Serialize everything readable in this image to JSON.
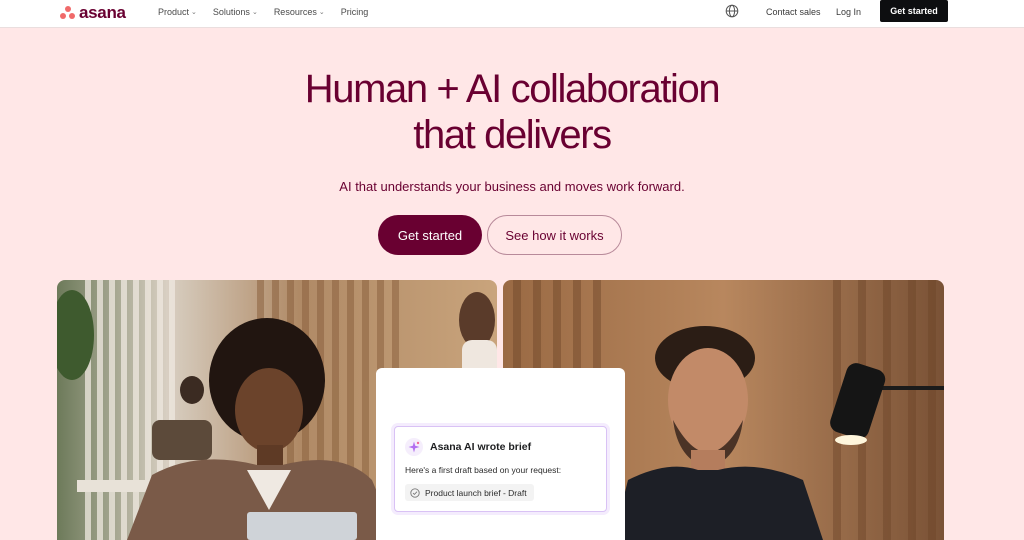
{
  "brand": {
    "name": "asana",
    "logo_color": "#f06a6a",
    "brand_color": "#690031"
  },
  "nav": {
    "items": [
      {
        "label": "Product",
        "has_dropdown": true
      },
      {
        "label": "Solutions",
        "has_dropdown": true
      },
      {
        "label": "Resources",
        "has_dropdown": true
      },
      {
        "label": "Pricing",
        "has_dropdown": false
      }
    ],
    "globe_icon": "globe-icon",
    "contact_sales": "Contact sales",
    "login": "Log In",
    "get_started": "Get started"
  },
  "hero": {
    "title_line1": "Human + AI collaboration",
    "title_line2": "that delivers",
    "subtitle": "AI that understands your business and moves work forward.",
    "primary_cta": "Get started",
    "secondary_cta": "See how it works",
    "background": "#ffe7e7"
  },
  "ai_card": {
    "icon": "sparkle-icon",
    "title": "Asana AI wrote brief",
    "body": "Here's a first draft based on your request:",
    "chip_icon": "check-circle-icon",
    "chip_label": "Product launch brief - Draft"
  }
}
